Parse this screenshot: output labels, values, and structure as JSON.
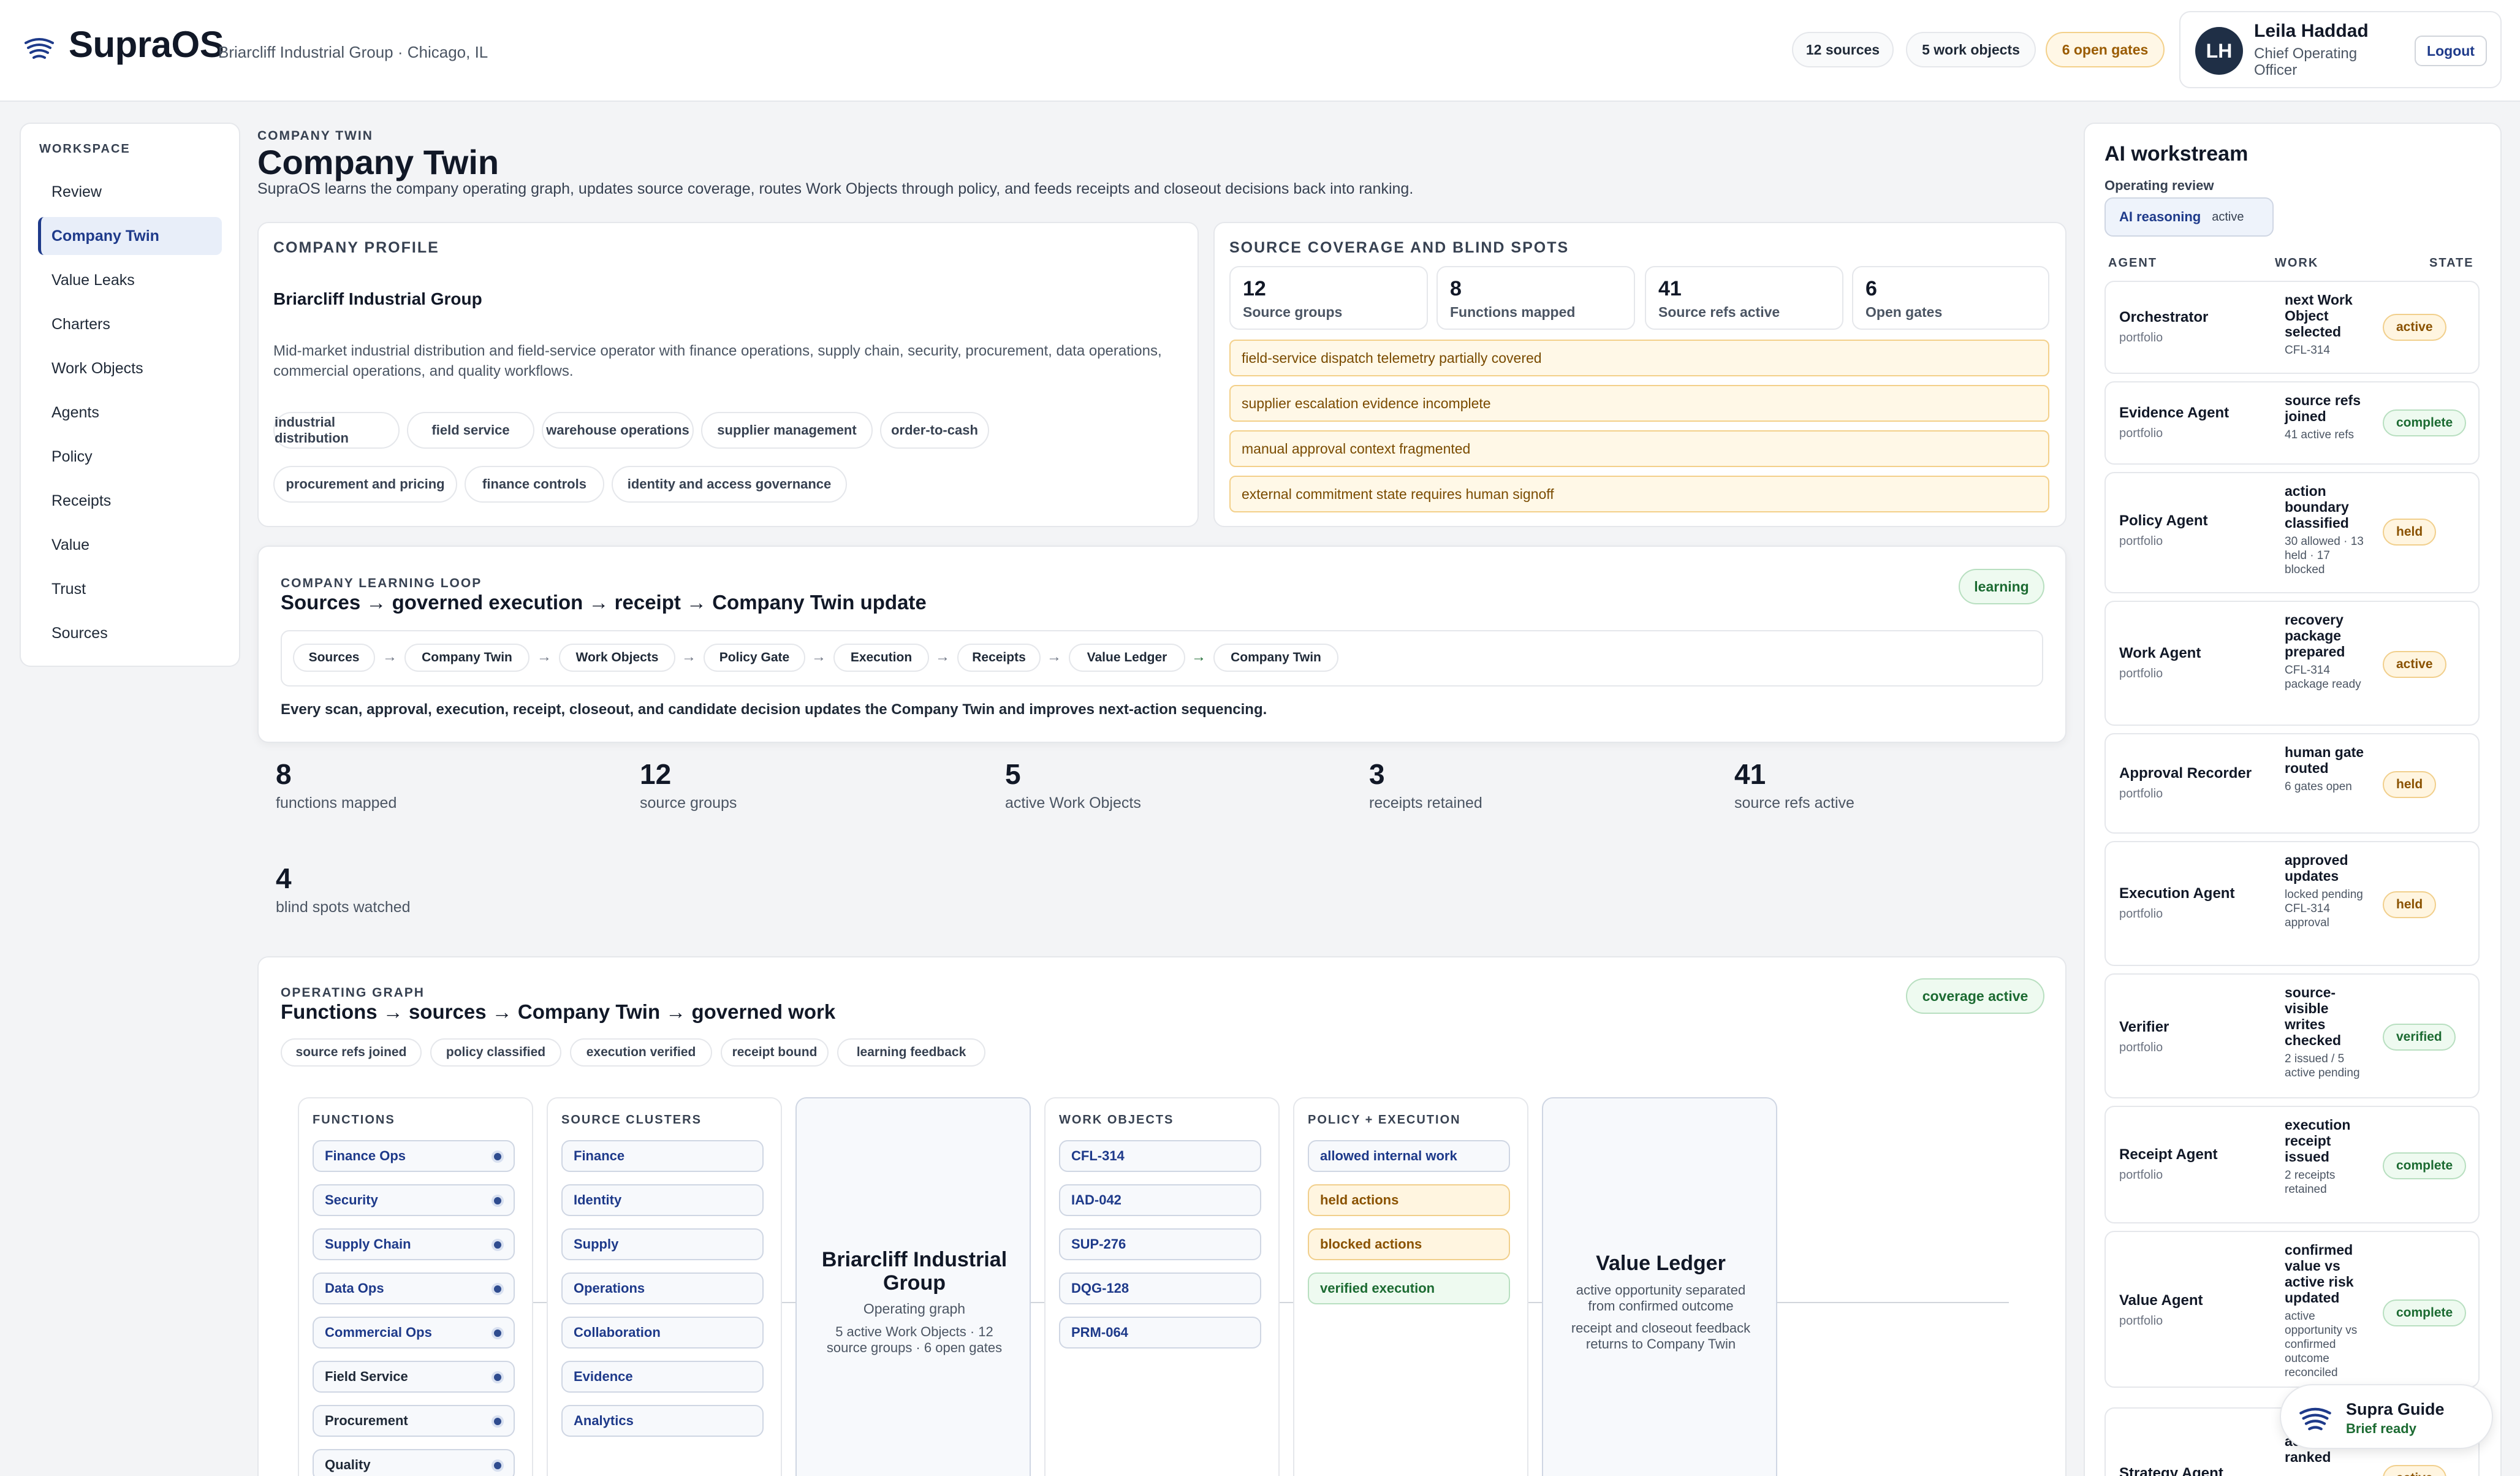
{
  "header": {
    "brand": "SupraOS",
    "org_line": "Briarcliff Industrial Group · Chicago, IL",
    "pills": {
      "sources": "12 sources",
      "work_objects": "5 work objects",
      "open_gates": "6 open gates"
    },
    "user": {
      "initials": "LH",
      "name": "Leila Haddad",
      "role": "Chief Operating Officer",
      "logout": "Logout"
    }
  },
  "sidebar": {
    "heading": "WORKSPACE",
    "items": [
      "Review",
      "Company Twin",
      "Value Leaks",
      "Charters",
      "Work Objects",
      "Agents",
      "Policy",
      "Receipts",
      "Value",
      "Trust",
      "Sources"
    ],
    "active": "Company Twin"
  },
  "page": {
    "eyebrow": "COMPANY TWIN",
    "title": "Company Twin",
    "subtitle": "SupraOS learns the company operating graph, updates source coverage, routes Work Objects through policy, and feeds receipts and closeout decisions back into ranking."
  },
  "profile": {
    "title": "COMPANY PROFILE",
    "name": "Briarcliff Industrial Group",
    "description": "Mid-market industrial distribution and field-service operator with finance operations, supply chain, security, procurement, data operations, commercial operations, and quality workflows.",
    "tags": [
      "industrial distribution",
      "field service",
      "warehouse operations",
      "supplier management",
      "order-to-cash",
      "procurement and pricing",
      "finance controls",
      "identity and access governance"
    ]
  },
  "coverage": {
    "title": "SOURCE COVERAGE AND BLIND SPOTS",
    "stats": [
      {
        "n": "12",
        "l": "Source groups"
      },
      {
        "n": "8",
        "l": "Functions mapped"
      },
      {
        "n": "41",
        "l": "Source refs active"
      },
      {
        "n": "6",
        "l": "Open gates"
      }
    ],
    "blind_spots": [
      "field-service dispatch telemetry partially covered",
      "supplier escalation evidence incomplete",
      "manual approval context fragmented",
      "external commitment state requires human signoff"
    ]
  },
  "loop": {
    "eyebrow": "COMPANY LEARNING LOOP",
    "title": "Sources → governed execution → receipt → Company Twin update",
    "badge": "learning",
    "nodes": [
      "Sources",
      "Company Twin",
      "Work Objects",
      "Policy Gate",
      "Execution",
      "Receipts",
      "Value Ledger",
      "Company Twin"
    ],
    "arrow": "→",
    "note": "Every scan, approval, execution, receipt, closeout, and candidate decision updates the Company Twin and improves next-action sequencing."
  },
  "metrics": [
    {
      "n": "8",
      "l": "functions mapped"
    },
    {
      "n": "12",
      "l": "source groups"
    },
    {
      "n": "5",
      "l": "active Work Objects"
    },
    {
      "n": "3",
      "l": "receipts retained"
    },
    {
      "n": "41",
      "l": "source refs active"
    },
    {
      "n": "4",
      "l": "blind spots watched"
    }
  ],
  "graph": {
    "eyebrow": "OPERATING GRAPH",
    "title": "Functions → sources → Company Twin → governed work",
    "badge": "coverage active",
    "pills": [
      "source refs joined",
      "policy classified",
      "execution verified",
      "receipt bound",
      "learning feedback"
    ],
    "functions": {
      "head": "FUNCTIONS",
      "items": [
        "Finance Ops",
        "Security",
        "Supply Chain",
        "Data Ops",
        "Commercial Ops",
        "Field Service",
        "Procurement",
        "Quality"
      ]
    },
    "sources": {
      "head": "SOURCE CLUSTERS",
      "items": [
        "Finance",
        "Identity",
        "Supply",
        "Operations",
        "Collaboration",
        "Evidence",
        "Analytics"
      ]
    },
    "twin": {
      "name": "Briarcliff Industrial Group",
      "sub": "Operating graph",
      "detail": "5 active Work Objects · 12 source groups · 6 open gates"
    },
    "work_objects": {
      "head": "WORK OBJECTS",
      "items": [
        "CFL-314",
        "IAD-042",
        "SUP-276",
        "DQG-128",
        "PRM-064"
      ]
    },
    "policy": {
      "head": "POLICY + EXECUTION",
      "items": [
        "allowed internal work",
        "held actions",
        "blocked actions",
        "verified execution"
      ]
    },
    "ledger": {
      "name": "Value Ledger",
      "line1": "active opportunity separated from confirmed outcome",
      "line2": "receipt and closeout feedback returns to Company Twin"
    }
  },
  "ai": {
    "title": "AI workstream",
    "subtitle": "Operating review",
    "reasoning": "AI reasoning",
    "reasoning_state": "active",
    "cols": {
      "agent": "AGENT",
      "work": "WORK",
      "state": "STATE"
    },
    "agents": [
      {
        "name": "Orchestrator",
        "scope": "portfolio",
        "work": "next Work Object selected",
        "detail": "CFL-314",
        "state": "active"
      },
      {
        "name": "Evidence Agent",
        "scope": "portfolio",
        "work": "source refs joined",
        "detail": "41 active refs",
        "state": "complete"
      },
      {
        "name": "Policy Agent",
        "scope": "portfolio",
        "work": "action boundary classified",
        "detail": "30 allowed · 13 held · 17 blocked",
        "state": "held"
      },
      {
        "name": "Work Agent",
        "scope": "portfolio",
        "work": "recovery package prepared",
        "detail": "CFL-314 package ready",
        "state": "active"
      },
      {
        "name": "Approval Recorder",
        "scope": "portfolio",
        "work": "human gate routed",
        "detail": "6 gates open",
        "state": "held"
      },
      {
        "name": "Execution Agent",
        "scope": "portfolio",
        "work": "approved updates",
        "detail": "locked pending CFL-314 approval",
        "state": "held"
      },
      {
        "name": "Verifier",
        "scope": "portfolio",
        "work": "source-visible writes checked",
        "detail": "2 issued / 5 active pending",
        "state": "verified"
      },
      {
        "name": "Receipt Agent",
        "scope": "portfolio",
        "work": "execution receipt issued",
        "detail": "2 receipts retained",
        "state": "complete"
      },
      {
        "name": "Value Agent",
        "scope": "portfolio",
        "work": "confirmed value vs active risk updated",
        "detail": "active opportunity vs confirmed outcome reconciled",
        "state": "complete"
      },
      {
        "name": "Strategy Agent",
        "scope": "portfolio",
        "work": "action re-ranked",
        "detail": "",
        "state": "active"
      }
    ]
  },
  "guide": {
    "title": "Supra Guide",
    "status": "Brief ready"
  },
  "colors": {
    "accent": "#1e3a8a",
    "warn": "#9a5b00",
    "ok": "#1c6b32"
  }
}
